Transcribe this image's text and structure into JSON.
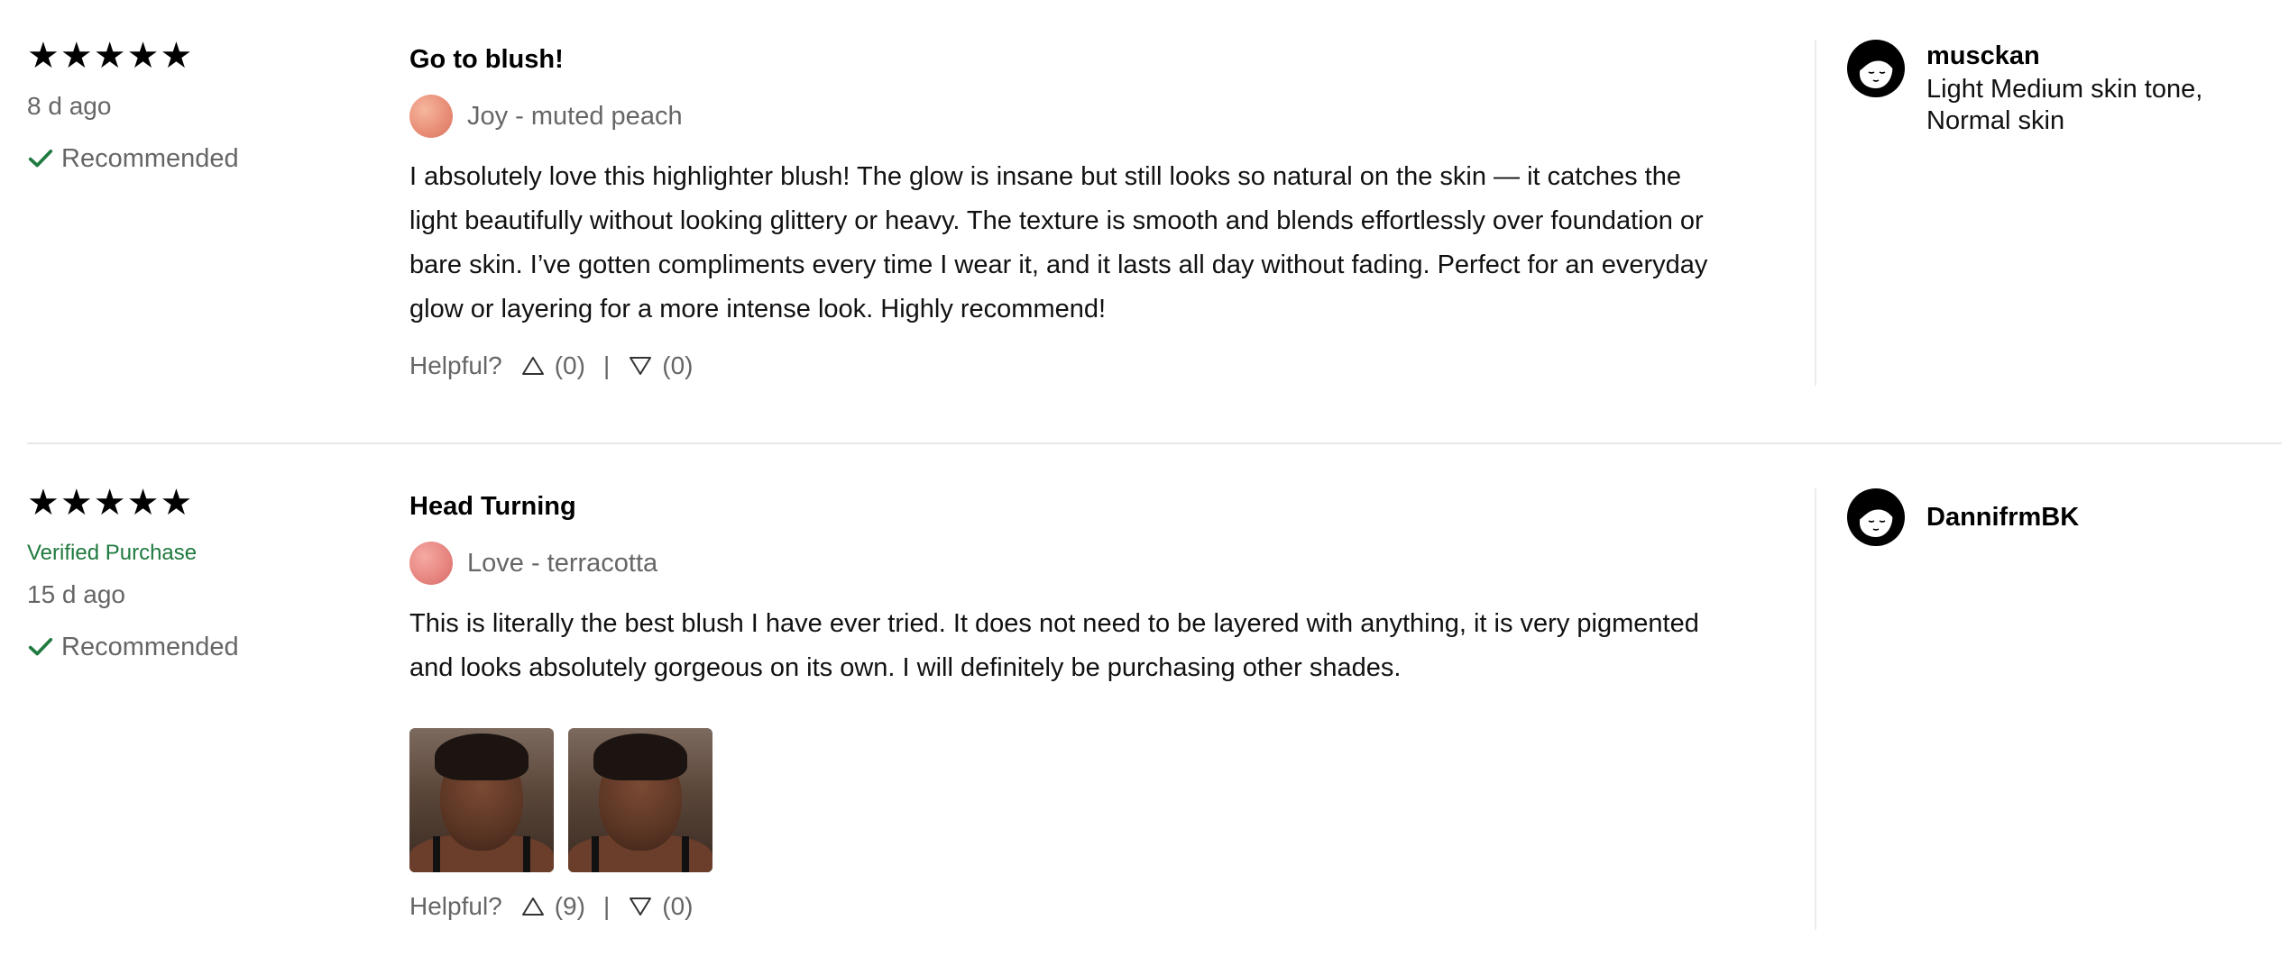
{
  "reviews": [
    {
      "stars": "★★★★★",
      "rating": 5,
      "verified": "",
      "date": "8 d ago",
      "recommended": "Recommended",
      "title": "Go to blush!",
      "shade": "Joy - muted peach",
      "body": "I absolutely love this highlighter blush! The glow is insane but still looks so natural on the skin — it catches the light beautifully without looking glittery or heavy. The texture is smooth and blends effortlessly over foundation or bare skin. I’ve gotten compliments every time I wear it, and it lasts all day without fading. Perfect for an everyday glow or layering for a more intense look. Highly recommend!",
      "helpful_label": "Helpful?",
      "upvotes": "(0)",
      "separator": "|",
      "downvotes": "(0)",
      "author": "musckan",
      "traits": "Light Medium skin tone, Normal skin"
    },
    {
      "stars": "★★★★★",
      "rating": 5,
      "verified": "Verified Purchase",
      "date": "15 d ago",
      "recommended": "Recommended",
      "title": "Head Turning",
      "shade": "Love - terracotta",
      "body": "This is literally the best blush I have ever tried. It does not need to be layered with anything, it is very pigmented and looks absolutely gorgeous on its own. I will definitely be purchasing other shades.",
      "photos_count": 2,
      "helpful_label": "Helpful?",
      "upvotes": "(9)",
      "separator": "|",
      "downvotes": "(0)",
      "author": "DannifrmBK",
      "traits": ""
    }
  ],
  "colors": {
    "verified": "#1f7a3f",
    "recommended_check": "#1f7a3f",
    "muted_text": "#666666",
    "swatch_peach": "#e98f78",
    "swatch_terracotta": "#e88782"
  },
  "icons": {
    "star": "star-icon",
    "check": "check-icon",
    "upvote": "thumb-up-triangle-icon",
    "downvote": "thumb-down-triangle-icon",
    "avatar": "user-avatar-icon"
  }
}
